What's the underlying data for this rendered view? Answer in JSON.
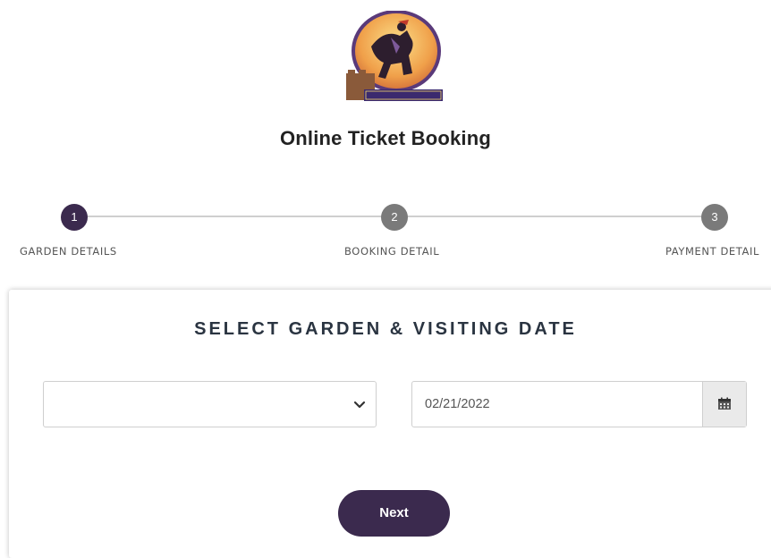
{
  "page": {
    "title": "Online Ticket Booking"
  },
  "stepper": {
    "steps": [
      {
        "number": "1",
        "label": "GARDEN DETAILS",
        "state": "active"
      },
      {
        "number": "2",
        "label": "BOOKING DETAIL",
        "state": "inactive"
      },
      {
        "number": "3",
        "label": "PAYMENT DETAIL",
        "state": "inactive"
      }
    ]
  },
  "form": {
    "heading": "SELECT GARDEN & VISITING DATE",
    "garden_select": {
      "value": ""
    },
    "date_input": {
      "value": "02/21/2022"
    },
    "next_label": "Next"
  },
  "colors": {
    "accent": "#3b2a4e",
    "inactive_step": "#7a7a7a",
    "heading": "#2a3441"
  },
  "icons": {
    "logo": "municipal-corporation-logo",
    "select_arrow": "chevron-down-icon",
    "date_picker": "calendar-icon"
  }
}
